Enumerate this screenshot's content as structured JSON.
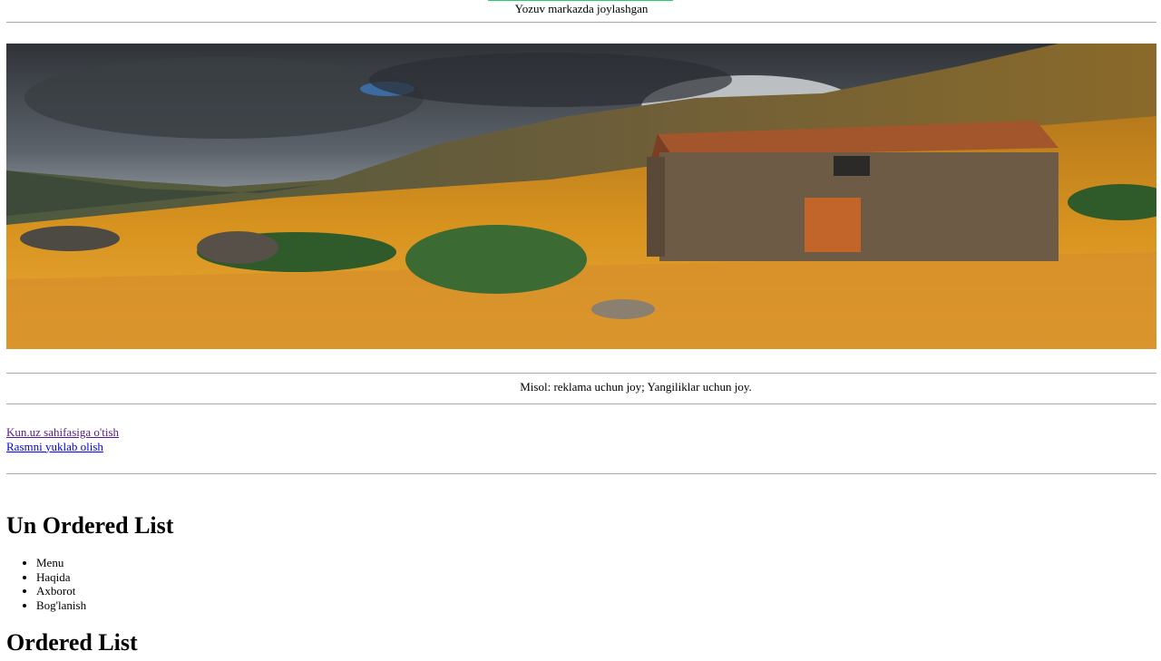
{
  "header": {
    "caption": "Yozuv markazda joylashgan",
    "accent_color": "#2ecc71"
  },
  "hero": {
    "description_icon": "landscape-photo"
  },
  "ad": {
    "text": "Misol: reklama uchun joy; Yangiliklar uchun joy."
  },
  "links": [
    {
      "label": "Kun.uz sahifasiga o'tish"
    },
    {
      "label": "Rasmni yuklab olish"
    }
  ],
  "lists": {
    "unordered_title": "Un Ordered List",
    "unordered_items": [
      "Menu",
      "Haqida",
      "Axborot",
      "Bog'lanish"
    ],
    "ordered_title": "Ordered List"
  }
}
